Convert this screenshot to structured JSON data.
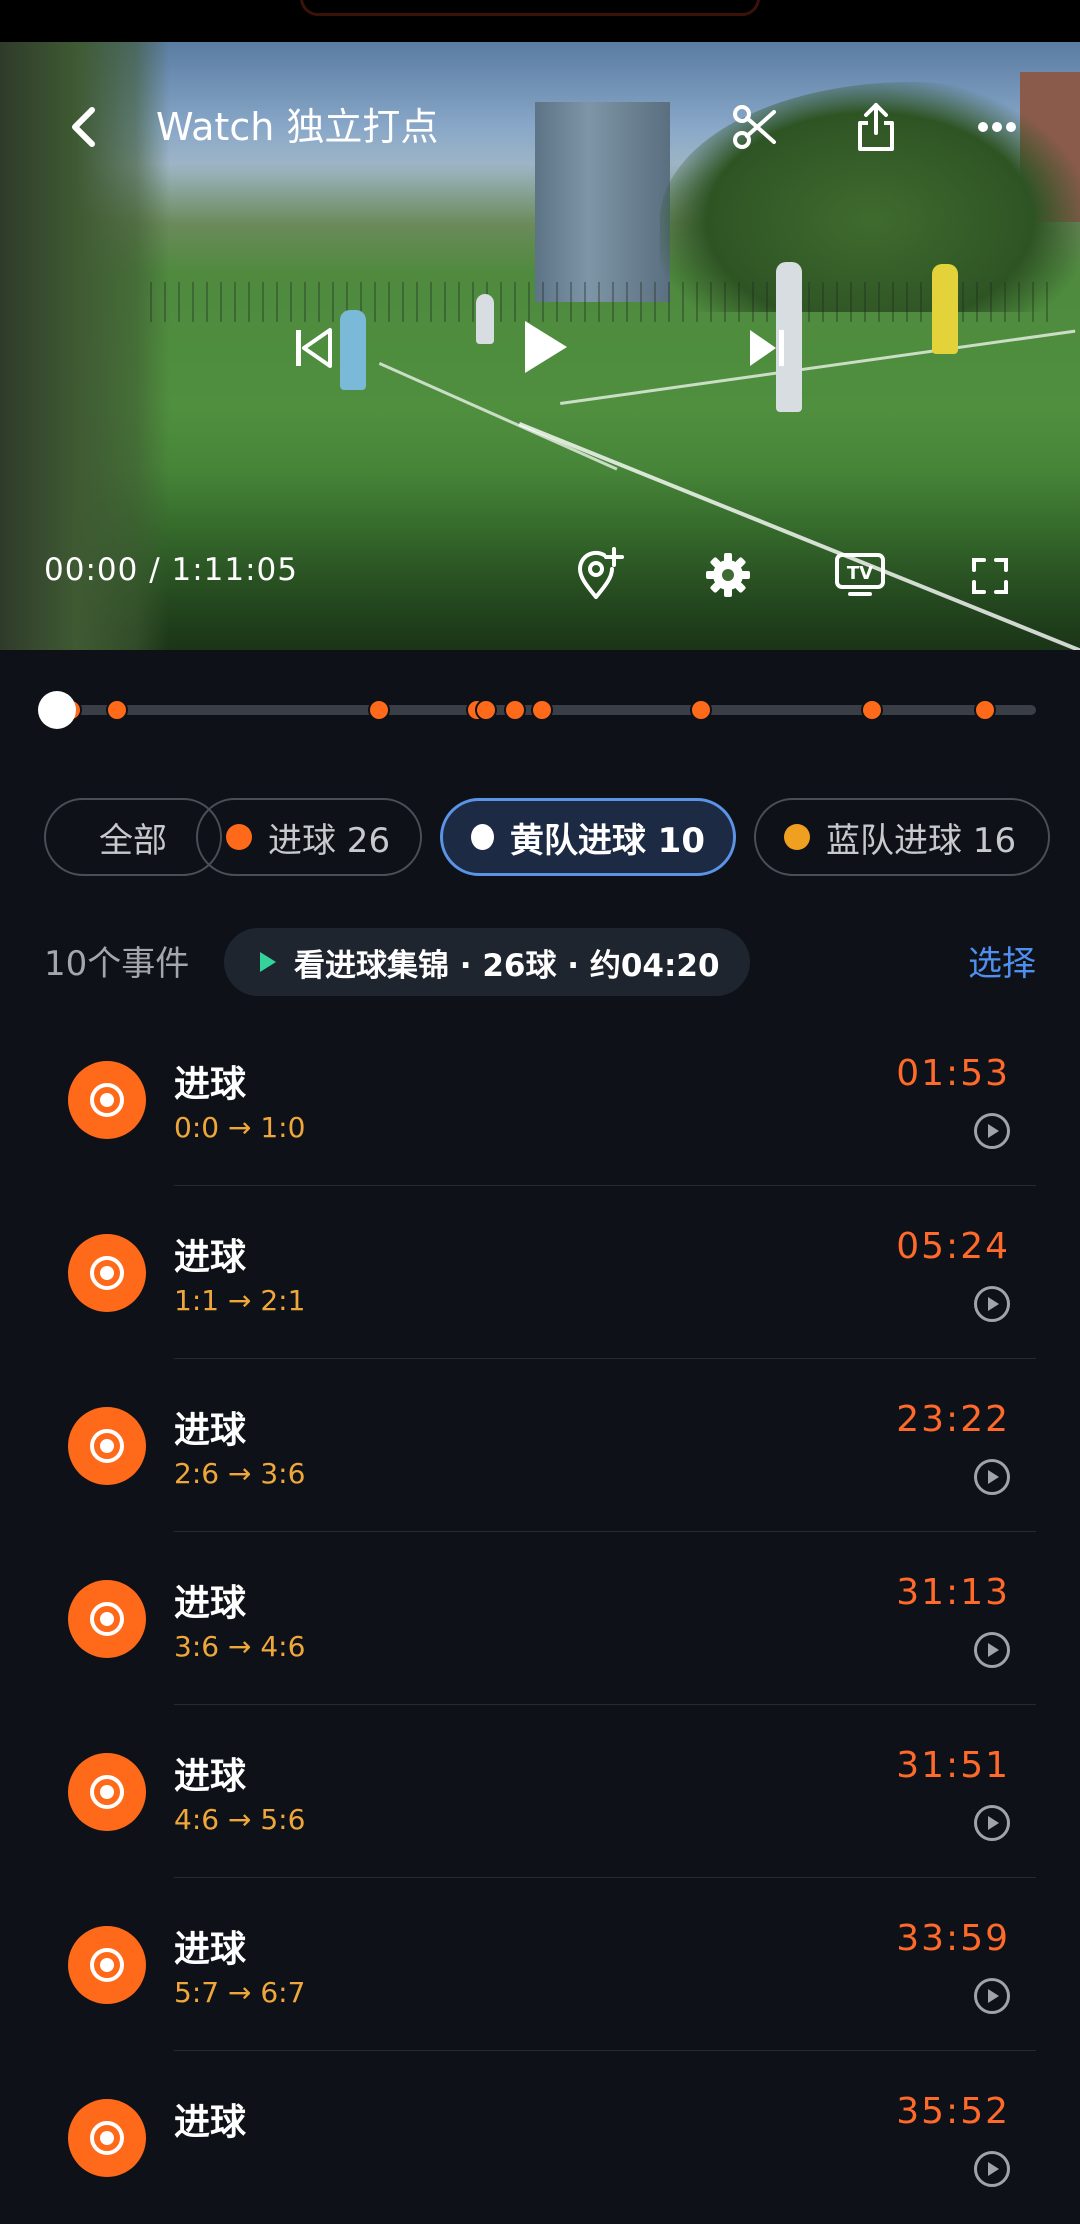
{
  "header": {
    "title": "Watch 独立打点",
    "back_icon": "chevron-left-icon",
    "actions": [
      "scissors-icon",
      "share-icon",
      "more-icon"
    ]
  },
  "player": {
    "time_readout": "00:00 / 1:11:05",
    "progress": 0,
    "controls": [
      "previous-icon",
      "play-icon",
      "next-icon",
      "add-marker-icon",
      "settings-icon",
      "tv-cast-icon",
      "fullscreen-icon"
    ]
  },
  "timeline": {
    "accent": "#ff6a1a"
  },
  "filters": [
    {
      "label": "全部",
      "dot_color": null,
      "active": false
    },
    {
      "label": "进球 26",
      "dot_color": "#ff6a1a",
      "active": false
    },
    {
      "label": "黄队进球 10",
      "dot_color": "#ffffff",
      "active": true
    },
    {
      "label": "蓝队进球 16",
      "dot_color": "#f0a020",
      "active": false
    }
  ],
  "summary": {
    "count": "10个事件",
    "highlight": "看进球集锦 · 26球 · 约04:20",
    "select": "选择"
  },
  "events": [
    {
      "title": "进球",
      "score": "0:0 → 1:0",
      "time": "01:53"
    },
    {
      "title": "进球",
      "score": "1:1 → 2:1",
      "time": "05:24"
    },
    {
      "title": "进球",
      "score": "2:6 → 3:6",
      "time": "23:22"
    },
    {
      "title": "进球",
      "score": "3:6 → 4:6",
      "time": "31:13"
    },
    {
      "title": "进球",
      "score": "4:6 → 5:6",
      "time": "31:51"
    },
    {
      "title": "进球",
      "score": "5:7 → 6:7",
      "time": "33:59"
    },
    {
      "title": "进球",
      "score": "",
      "time": "35:52"
    }
  ],
  "colors": {
    "background": "#0e1218",
    "accent_orange": "#ff6a1a",
    "score_yellow": "#f0a73a",
    "link_blue": "#4f8ff0",
    "active_chip_border": "#5b94e6"
  }
}
